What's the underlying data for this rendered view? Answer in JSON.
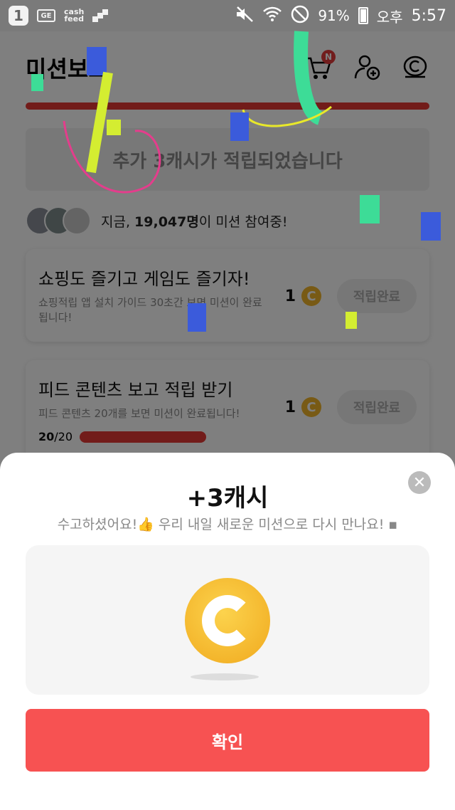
{
  "status_bar": {
    "app_icon_text": "1",
    "ge_icon_text": "GE",
    "cashfeed_line1": "cash",
    "cashfeed_line2": "feed",
    "battery_percent": "91%",
    "ampm": "오후",
    "time": "5:57"
  },
  "header": {
    "title": "미션보드",
    "cart_badge": "N"
  },
  "banner": {
    "text": "추가 3캐시가 적립되었습니다"
  },
  "participants": {
    "prefix": "지금, ",
    "count": "19,047명",
    "suffix": "이 미션 참여중!"
  },
  "missions": [
    {
      "title": "쇼핑도 즐기고 게임도 즐기자!",
      "desc": "쇼핑적립 앱 설치 가이드 30초간 보면 미션이 완료됩니다!",
      "reward": "1",
      "coin_symbol": "C",
      "button": "적립완료"
    },
    {
      "title": "피드 콘텐츠 보고 적립 받기",
      "desc": "피드 콘텐츠 20개를 보면 미션이 완료됩니다!",
      "reward": "1",
      "coin_symbol": "C",
      "button": "적립완료",
      "progress_done": "20",
      "progress_total": "/20",
      "progress_fraction": 1.0
    }
  ],
  "sheet": {
    "title": "+3캐시",
    "subtitle": "수고하셨어요!👍 우리 내일 새로운 미션으로 다시 만나요! ▪",
    "close_symbol": "✕",
    "confirm_label": "확인"
  },
  "colors": {
    "accent_red": "#f75252",
    "progress_red": "#e53935",
    "coin_gold": "#f0b52a"
  }
}
